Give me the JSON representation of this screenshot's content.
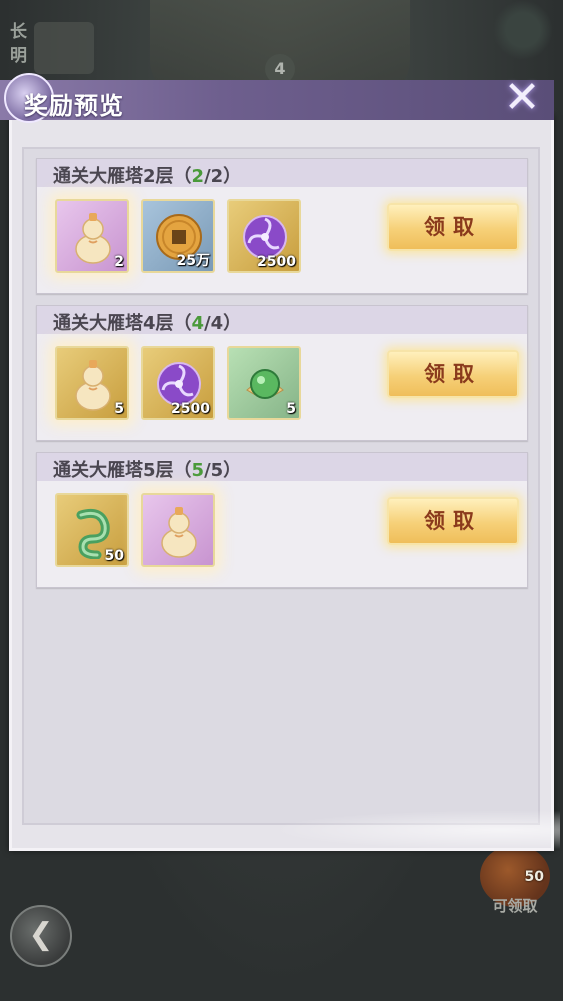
{
  "background": {
    "side_text": "长明",
    "floor_number": "4",
    "claim_badge": {
      "count": "50",
      "label": "可领取"
    }
  },
  "dialog": {
    "title": "奖励预览",
    "claim_label": "领取",
    "rewards": [
      {
        "title": "通关大雁塔2层（",
        "progress_current": "2",
        "progress_rest": "/2）",
        "items": [
          {
            "icon": "gourd-icon",
            "rarity": "purple",
            "count": "2"
          },
          {
            "icon": "copper-coin-icon",
            "rarity": "blue",
            "count": "25万"
          },
          {
            "icon": "purple-orb-icon",
            "rarity": "gold",
            "count": "2500"
          }
        ]
      },
      {
        "title": "通关大雁塔4层（",
        "progress_current": "4",
        "progress_rest": "/4）",
        "items": [
          {
            "icon": "gourd-icon",
            "rarity": "gold",
            "count": "5"
          },
          {
            "icon": "purple-orb-icon",
            "rarity": "gold",
            "count": "2500"
          },
          {
            "icon": "green-bead-icon",
            "rarity": "green",
            "count": "5"
          }
        ]
      },
      {
        "title": "通关大雁塔5层（",
        "progress_current": "5",
        "progress_rest": "/5）",
        "items": [
          {
            "icon": "jade-dragon-icon",
            "rarity": "gold",
            "count": "50"
          },
          {
            "icon": "gourd-icon",
            "rarity": "purple",
            "count": ""
          }
        ]
      }
    ]
  },
  "colors": {
    "progress_green": "#4a9a3a",
    "claim_text": "#8a3a1c",
    "header_purple": "#6e5f8e"
  }
}
